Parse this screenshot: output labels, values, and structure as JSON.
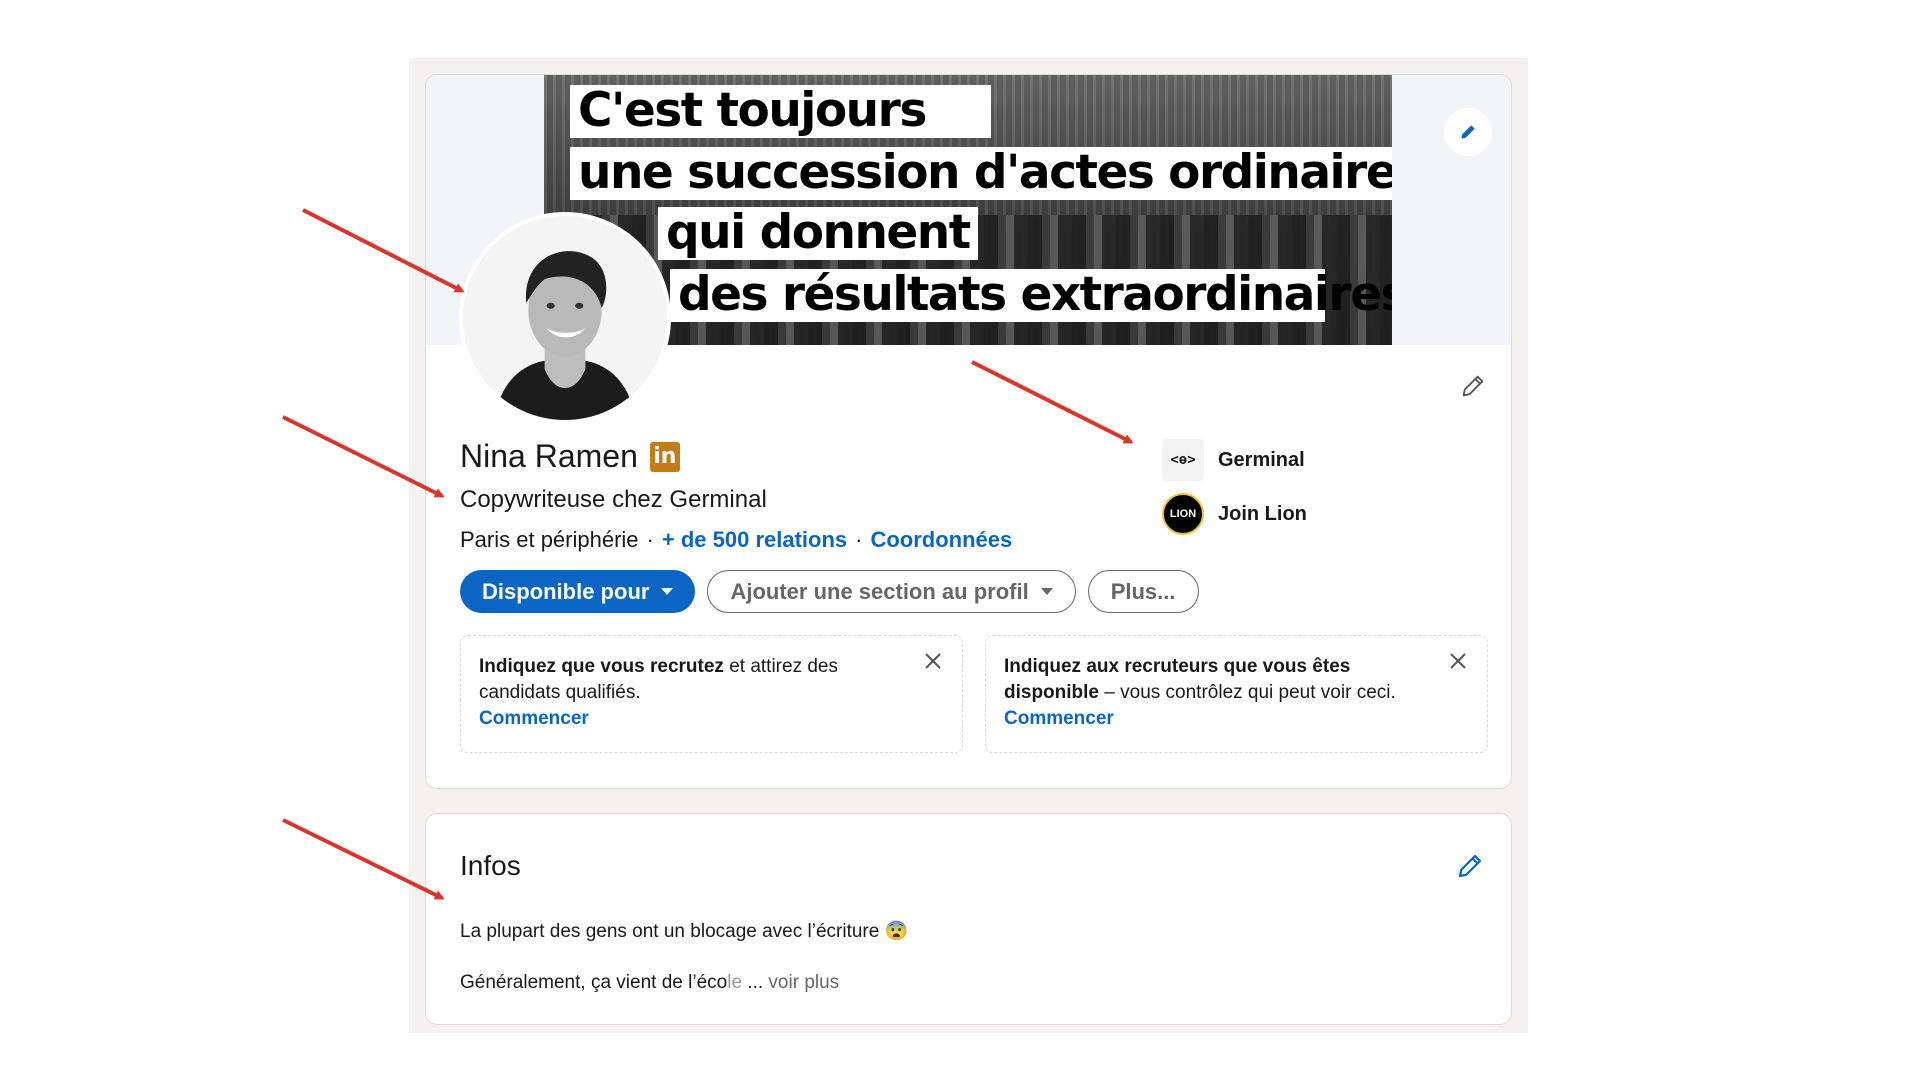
{
  "banner": {
    "quote_lines": [
      "C'est toujours",
      "une succession d'actes ordinaires",
      "qui donnent",
      "des résultats extraordinaires."
    ]
  },
  "profile": {
    "name": "Nina Ramen",
    "badge": "in",
    "headline": "Copywriteuse chez Germinal",
    "location": "Paris et périphérie",
    "connections": "+ de 500 relations",
    "contact_link": "Coordonnées",
    "separator": "·"
  },
  "experience": [
    {
      "logo": "<ɵ>",
      "name": "Germinal"
    },
    {
      "logo": "LION",
      "name": "Join Lion"
    }
  ],
  "actions": {
    "primary": "Disponible pour",
    "add_section": "Ajouter une section au profil",
    "more": "Plus..."
  },
  "promos": [
    {
      "bold": "Indiquez que vous recrutez",
      "text": " et attirez des candidats qualifiés.",
      "cta": "Commencer"
    },
    {
      "bold": "Indiquez aux recruteurs que vous êtes disponible",
      "text": " – vous contrôlez qui peut voir ceci.",
      "cta": "Commencer"
    }
  ],
  "infos": {
    "title": "Infos",
    "line1": "La plupart des gens ont un blocage avec l’écriture 😨",
    "line2_start": "Généralement, ça vient de l’éco",
    "line2_fade": "le",
    "ellipsis": " ...",
    "see_more": " voir plus"
  },
  "colors": {
    "accent": "#0a66c2",
    "annotation_arrow": "#d9362b",
    "linkedin_badge": "#c37d16",
    "page_bg": "#f3f2ef"
  },
  "icons": {
    "banner_edit": "pencil-icon",
    "intro_edit": "pencil-icon",
    "infos_edit": "pencil-icon",
    "dismiss": "close-icon"
  }
}
